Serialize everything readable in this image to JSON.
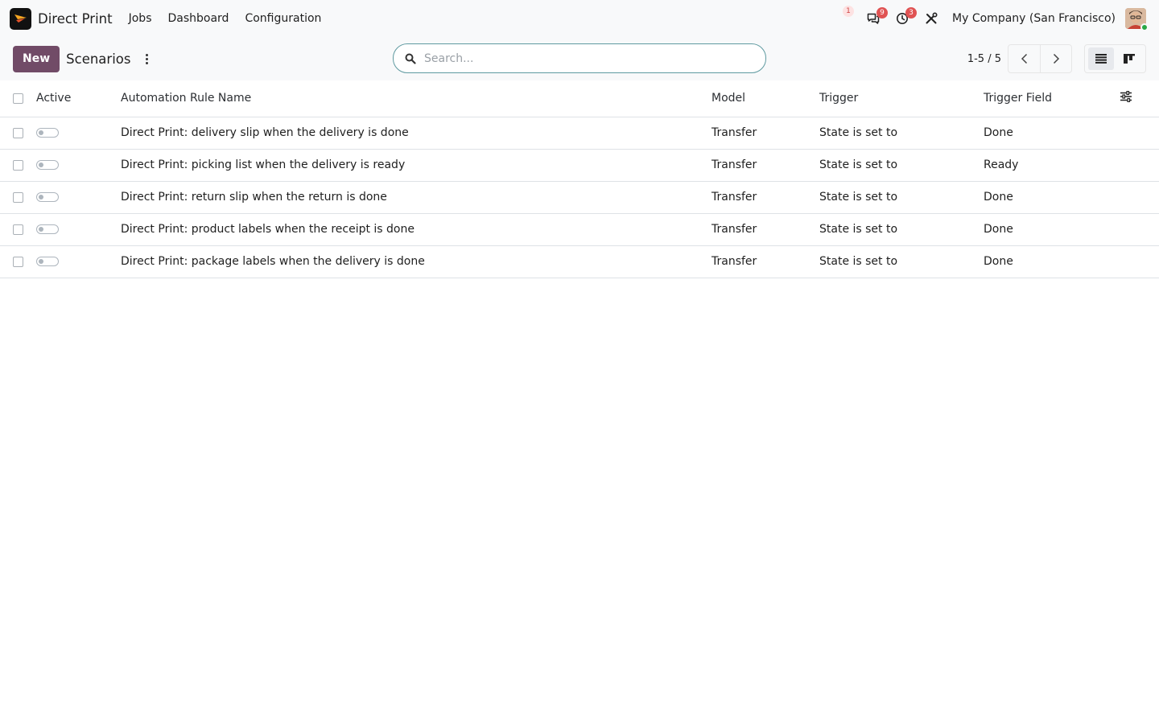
{
  "navbar": {
    "app_name": "Direct Print",
    "menus": [
      "Jobs",
      "Dashboard",
      "Configuration"
    ],
    "systray": {
      "notification_count": "1",
      "messages_count": "9",
      "activities_count": "3"
    },
    "company": "My Company (San Francisco)"
  },
  "control_panel": {
    "new_label": "New",
    "title": "Scenarios",
    "search_placeholder": "Search...",
    "pager": "1-5 / 5"
  },
  "table": {
    "headers": {
      "active": "Active",
      "name": "Automation Rule Name",
      "model": "Model",
      "trigger": "Trigger",
      "trigger_field": "Trigger Field"
    },
    "rows": [
      {
        "name": "Direct Print: delivery slip when the delivery is done",
        "model": "Transfer",
        "trigger": "State is set to",
        "trigger_field": "Done"
      },
      {
        "name": "Direct Print: picking list when the delivery is ready",
        "model": "Transfer",
        "trigger": "State is set to",
        "trigger_field": "Ready"
      },
      {
        "name": "Direct Print: return slip when the return is done",
        "model": "Transfer",
        "trigger": "State is set to",
        "trigger_field": "Done"
      },
      {
        "name": "Direct Print: product labels when the receipt is done",
        "model": "Transfer",
        "trigger": "State is set to",
        "trigger_field": "Done"
      },
      {
        "name": "Direct Print: package labels when the delivery is done",
        "model": "Transfer",
        "trigger": "State is set to",
        "trigger_field": "Done"
      }
    ]
  },
  "colors": {
    "primary": "#714b67",
    "badge": "#e05353",
    "search_border": "#5f9aa0"
  },
  "icons": {
    "app_logo": "direct-print-logo",
    "messages": "chat-icon",
    "activities": "clock-icon",
    "debug": "tools-icon"
  }
}
